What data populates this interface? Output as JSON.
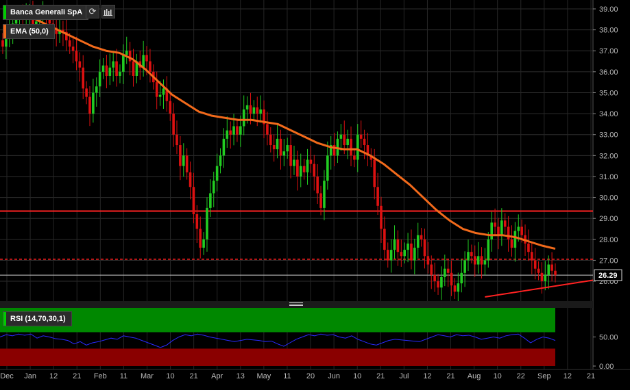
{
  "instrument": {
    "name": "Banca Generali SpA",
    "name_color": "#00cc00"
  },
  "toolbar": {
    "refresh_icon": "refresh-icon",
    "chart_type_icon": "bar-chart-icon"
  },
  "indicators": {
    "ema_label": "EMA (50,0)",
    "ema_color": "#f26a1b",
    "rsi_label": "RSI (14,70,30,1)",
    "rsi_color": "#2a2aff"
  },
  "colors": {
    "up": "#22cc22",
    "down": "#dd1111",
    "support_line": "#ff2222",
    "rsi_overbought_band": "#008800",
    "rsi_oversold_band": "#8a0000"
  },
  "chart_data": [
    {
      "type": "candlestick",
      "title": "",
      "x_ticks": [
        "Dec",
        "Jan",
        "12",
        "21",
        "Feb",
        "11",
        "Mar",
        "10",
        "21",
        "Apr",
        "13",
        "May",
        "11",
        "20",
        "Jun",
        "10",
        "21",
        "Jul",
        "12",
        "21",
        "Aug",
        "10",
        "22",
        "Sep",
        "12",
        "21"
      ],
      "y_ticks": [
        "39.00",
        "38.00",
        "37.00",
        "36.00",
        "35.00",
        "34.00",
        "33.00",
        "32.00",
        "31.00",
        "30.00",
        "29.00",
        "28.00",
        "27.00",
        "26.00"
      ],
      "ylim": [
        25.0,
        39.2
      ],
      "last_price": "26.29",
      "horizontal_lines": [
        {
          "value": 29.35,
          "style": "solid"
        },
        {
          "value": 27.05,
          "style": "dashed"
        },
        {
          "value": 26.29,
          "style": "last-price"
        }
      ],
      "trendline": {
        "from": [
          144,
          25.25
        ],
        "to": [
          186,
          26.05
        ]
      },
      "closes": [
        37.2,
        37.6,
        38.0,
        38.3,
        38.6,
        38.7,
        38.5,
        38.6,
        38.8,
        38.2,
        38.4,
        38.6,
        38.7,
        38.5,
        38.3,
        38.1,
        37.8,
        38.0,
        37.9,
        37.5,
        37.2,
        37.0,
        36.5,
        36.2,
        35.2,
        34.8,
        34.0,
        35.0,
        35.3,
        36.0,
        36.3,
        35.8,
        36.2,
        36.5,
        35.8,
        36.0,
        36.8,
        37.0,
        36.5,
        35.8,
        36.5,
        36.2,
        36.8,
        36.5,
        36.0,
        35.5,
        34.8,
        34.9,
        35.2,
        34.6,
        34.0,
        33.0,
        32.5,
        31.5,
        32.0,
        31.2,
        30.5,
        29.2,
        28.5,
        27.6,
        28.0,
        29.5,
        30.2,
        30.8,
        31.5,
        32.0,
        32.8,
        33.2,
        33.0,
        33.4,
        33.0,
        33.4,
        34.2,
        34.4,
        34.0,
        34.3,
        34.0,
        34.2,
        33.5,
        33.0,
        32.5,
        32.3,
        32.8,
        32.0,
        32.2,
        32.5,
        31.5,
        31.8,
        31.0,
        31.5,
        31.2,
        31.8,
        31.6,
        31.0,
        30.2,
        29.5,
        30.8,
        32.0,
        32.5,
        32.0,
        32.8,
        33.0,
        32.5,
        32.8,
        32.0,
        31.8,
        33.0,
        32.8,
        32.5,
        32.0,
        31.8,
        30.5,
        29.6,
        28.5,
        27.5,
        27.0,
        27.5,
        28.0,
        27.4,
        27.2,
        27.5,
        27.8,
        27.0,
        27.6,
        28.2,
        28.0,
        27.2,
        26.8,
        26.3,
        26.0,
        25.7,
        26.2,
        26.6,
        26.4,
        25.8,
        25.5,
        25.9,
        26.4,
        27.0,
        27.4,
        27.2,
        26.8,
        27.2,
        26.8,
        27.0,
        28.0,
        28.8,
        28.6,
        28.2,
        28.9,
        28.6,
        28.0,
        27.6,
        28.4,
        28.6,
        28.2,
        27.8,
        27.4,
        27.0,
        26.6,
        26.4,
        26.0,
        26.3,
        26.8,
        26.5,
        26.29
      ],
      "ema": [
        38.9,
        38.7,
        38.4,
        38.1,
        37.8,
        37.5,
        37.2,
        37.0,
        36.9,
        36.6,
        36.1,
        35.5,
        34.9,
        34.5,
        34.1,
        33.9,
        33.8,
        33.7,
        33.7,
        33.6,
        33.5,
        33.2,
        32.9,
        32.6,
        32.4,
        32.3,
        32.3,
        32.0,
        31.6,
        31.1,
        30.6,
        30.0,
        29.4,
        28.9,
        28.5,
        28.3,
        28.2,
        28.2,
        28.1,
        27.9,
        27.7,
        27.55
      ],
      "rsi": [
        50,
        54,
        52,
        55,
        53,
        55,
        48,
        52,
        50,
        47,
        46,
        44,
        38,
        42,
        36,
        40,
        42,
        45,
        48,
        46,
        52,
        50,
        48,
        44,
        40,
        36,
        32,
        36,
        44,
        50,
        54,
        52,
        55,
        53,
        50,
        48,
        46,
        44,
        42,
        44,
        46,
        45,
        44,
        42,
        43,
        38,
        34,
        40,
        46,
        50,
        54,
        52,
        55,
        53,
        54,
        50,
        48,
        52,
        46,
        42,
        38,
        36,
        40,
        44,
        46,
        45,
        44,
        43,
        42,
        46,
        50,
        54,
        52,
        50,
        54,
        52,
        53,
        50,
        46,
        48,
        50,
        48,
        52,
        54,
        55,
        48,
        40,
        46,
        50,
        48,
        44
      ],
      "rsi_ticks": [
        "50.00",
        "0.00"
      ],
      "rsi_bands": {
        "overbought": 70,
        "oversold": 30
      }
    }
  ]
}
